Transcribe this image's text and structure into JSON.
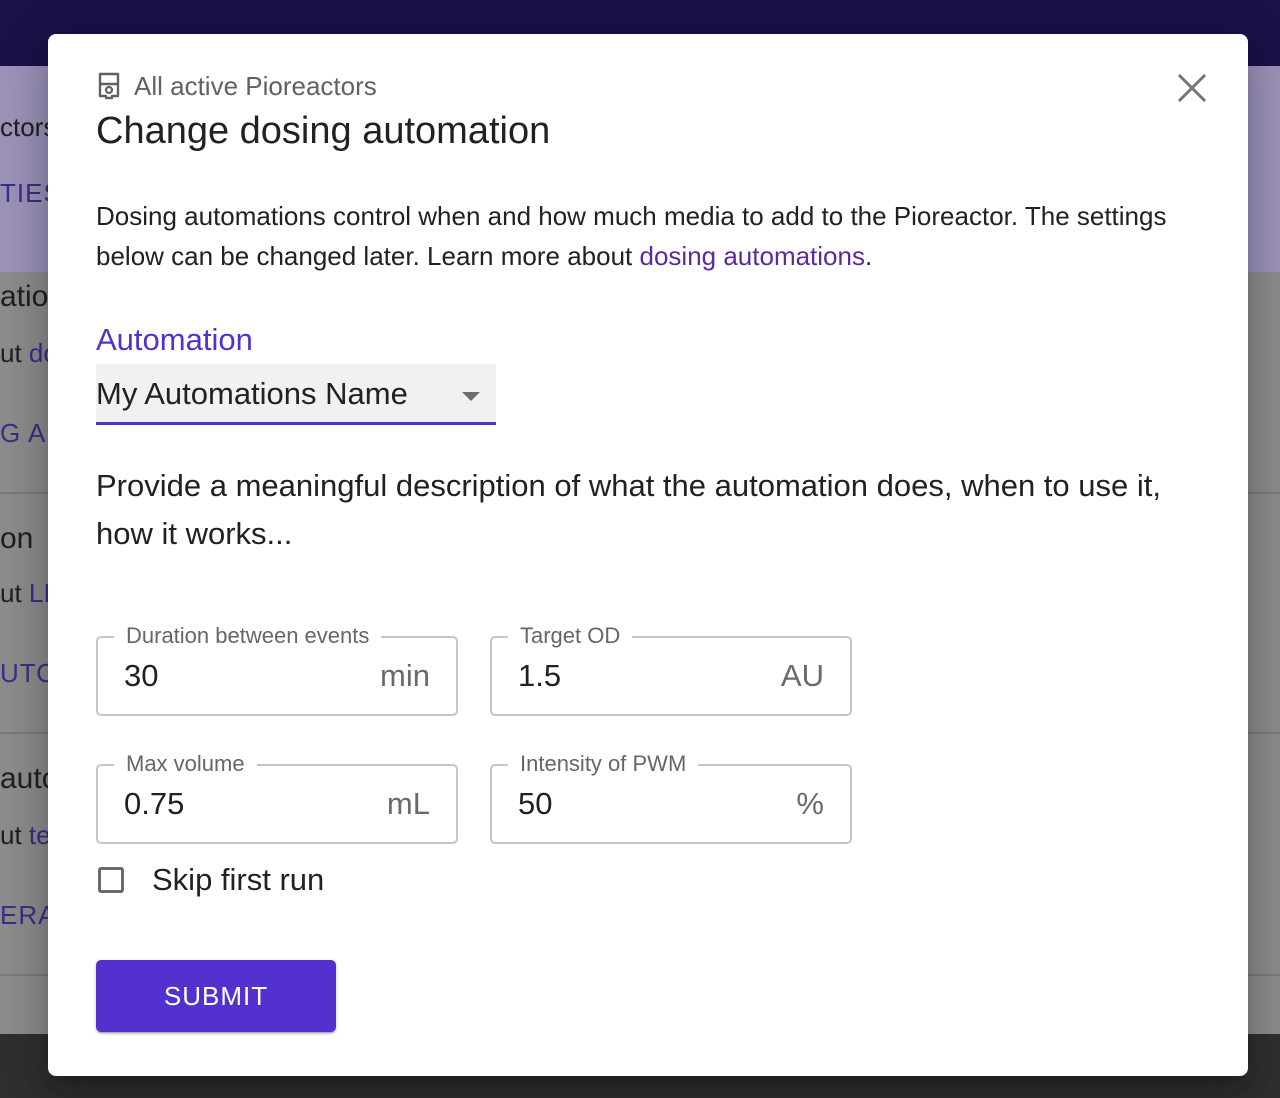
{
  "background": {
    "fragments": [
      "ctors",
      "TIES",
      "atio",
      "ut",
      "do",
      "G AU",
      "on",
      "ut",
      "LI",
      "UTO",
      "auto",
      "ut",
      "te",
      "ERAT"
    ]
  },
  "dialog": {
    "subtitle": "All active Pioreactors",
    "title": "Change dosing automation",
    "intro_text": "Dosing automations control when and how much media to add to the Pioreactor. The settings below can be changed later. Learn more about ",
    "intro_link": "dosing automations",
    "intro_end": ".",
    "automation_label": "Automation",
    "automation_selected": "My Automations Name",
    "automation_description": "Provide a meaningful description of what the automation does, when to use it, how it works...",
    "fields": [
      {
        "label": "Duration between events",
        "value": "30",
        "unit": "min"
      },
      {
        "label": "Target OD",
        "value": "1.5",
        "unit": "AU"
      },
      {
        "label": "Max volume",
        "value": "0.75",
        "unit": "mL"
      },
      {
        "label": "Intensity of PWM",
        "value": "50",
        "unit": "%"
      }
    ],
    "checkbox_label": "Skip first run",
    "checkbox_checked": false,
    "submit_label": "SUBMIT",
    "icons": {
      "subtitle": "pioreactor-icon",
      "close": "close-icon",
      "select": "chevron-down-icon"
    },
    "colors": {
      "primary": "#5331cf",
      "link": "#5b2a9e",
      "topbar": "#1a1148"
    }
  }
}
